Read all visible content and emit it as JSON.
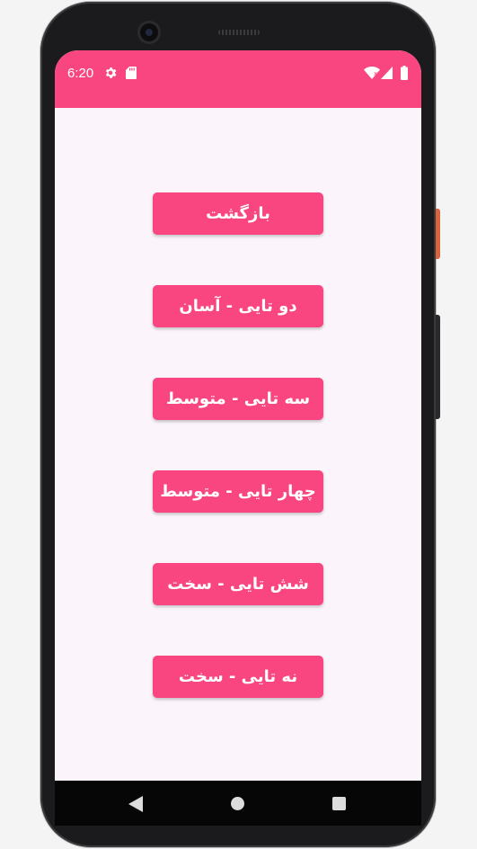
{
  "status_bar": {
    "time": "6:20",
    "icons": [
      "gear-icon",
      "sd-card-icon",
      "wifi-icon",
      "signal-icon",
      "battery-icon"
    ],
    "background": "#f94580"
  },
  "menu": {
    "back": "بازگشت",
    "items": [
      "دو تایی - آسان",
      "سه تایی - متوسط",
      "چهار تایی - متوسط",
      "شش تایی - سخت",
      "نه تایی - سخت"
    ],
    "button_color": "#f94580",
    "text_color": "#ffffff"
  },
  "nav_bar": {
    "icons": [
      "back-icon",
      "home-icon",
      "recents-icon"
    ]
  },
  "screen_background": "#fbf5fb"
}
